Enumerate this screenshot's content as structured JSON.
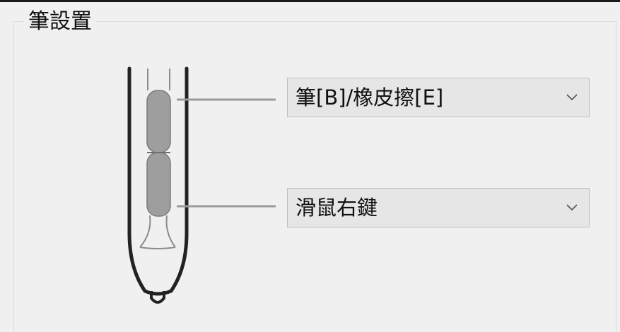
{
  "group": {
    "title": "筆設置"
  },
  "pen_buttons": {
    "upper": {
      "value": "筆[B]/橡皮擦[E]",
      "icon": "chevron-down-icon"
    },
    "lower": {
      "value": "滑鼠右鍵",
      "icon": "chevron-down-icon"
    }
  },
  "colors": {
    "background": "#f0f0f0",
    "combo_background": "#e6e6e6",
    "combo_border": "#bdbdbd",
    "pen_outline": "#222222",
    "pen_button_fill": "#9e9e9e",
    "leader_line": "#9a9a9a"
  }
}
